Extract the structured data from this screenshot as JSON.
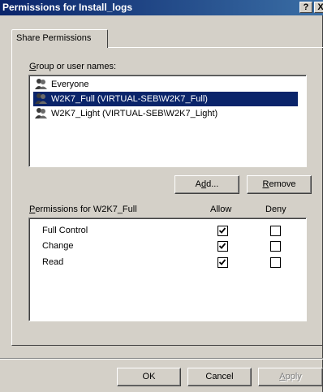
{
  "window": {
    "title": "Permissions for Install_logs",
    "help_label": "?",
    "close_label": "X"
  },
  "tabs": [
    {
      "label": "Share Permissions"
    }
  ],
  "users": {
    "label_prefix": "G",
    "label_rest": "roup or user names:",
    "items": [
      {
        "label": "Everyone",
        "selected": false
      },
      {
        "label": "W2K7_Full (VIRTUAL-SEB\\W2K7_Full)",
        "selected": true
      },
      {
        "label": "W2K7_Light (VIRTUAL-SEB\\W2K7_Light)",
        "selected": false
      }
    ]
  },
  "buttons": {
    "add_pre": "A",
    "add_ul": "d",
    "add_post": "d...",
    "remove_ul": "R",
    "remove_post": "emove",
    "ok": "OK",
    "cancel": "Cancel",
    "apply_ul": "A",
    "apply_post": "pply"
  },
  "permissions": {
    "label_ul": "P",
    "label_rest": "ermissions for W2K7_Full",
    "col_allow": "Allow",
    "col_deny": "Deny",
    "rows": [
      {
        "name": "Full Control",
        "allow": true,
        "deny": false
      },
      {
        "name": "Change",
        "allow": true,
        "deny": false
      },
      {
        "name": "Read",
        "allow": true,
        "deny": false
      }
    ]
  }
}
